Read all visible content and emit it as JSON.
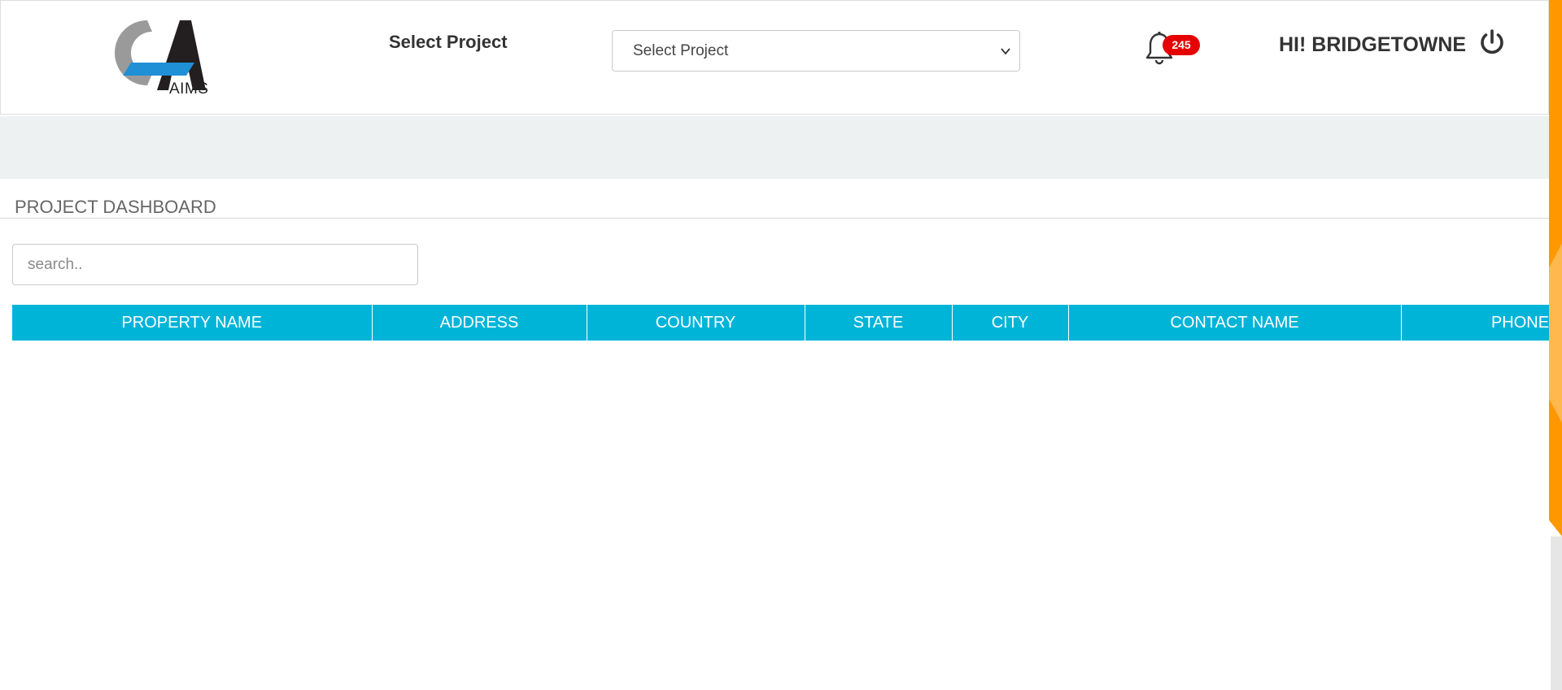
{
  "header": {
    "logo_text": "AIMS",
    "select_label": "Select Project",
    "project_select": {
      "selected": "Select Project",
      "options": [
        "Select Project"
      ]
    },
    "notifications": {
      "count": "245"
    },
    "greeting": "HI! BRIDGETOWNE"
  },
  "dashboard": {
    "title": "PROJECT DASHBOARD",
    "search": {
      "placeholder": "search..",
      "value": ""
    },
    "table": {
      "columns": [
        "PROPERTY NAME",
        "ADDRESS",
        "COUNTRY",
        "STATE",
        "CITY",
        "CONTACT NAME",
        "PHONE"
      ],
      "rows": []
    }
  },
  "colors": {
    "table_header": "#00b4d8",
    "badge": "#e60000",
    "accent_orange": "#ff9800",
    "band": "#eef1f1",
    "logo_blue": "#1f8fd6",
    "logo_gray": "#9a9a9a",
    "logo_dark": "#231f20"
  },
  "icons": {
    "logo": "aims-logo",
    "bell": "bell-icon",
    "power": "power-icon",
    "chevron": "chevron-down-icon"
  }
}
